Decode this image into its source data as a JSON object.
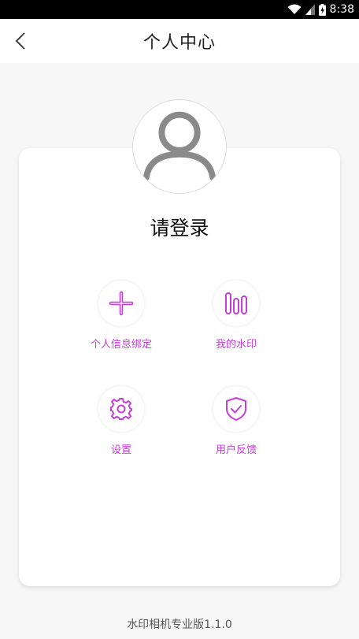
{
  "status_bar": {
    "time": "8:38"
  },
  "header": {
    "title": "个人中心",
    "back_icon": "chevron-left-icon"
  },
  "profile": {
    "avatar_icon": "user-avatar-icon",
    "login_text": "请登录"
  },
  "menu": {
    "accent_color": "#c43fd6",
    "items": [
      {
        "label": "个人信息绑定",
        "icon": "plus-icon"
      },
      {
        "label": "我的水印",
        "icon": "bars-icon"
      },
      {
        "label": "设置",
        "icon": "gear-icon"
      },
      {
        "label": "用户反馈",
        "icon": "shield-check-icon"
      }
    ]
  },
  "footer": {
    "version": "水印相机专业版1.1.0"
  }
}
